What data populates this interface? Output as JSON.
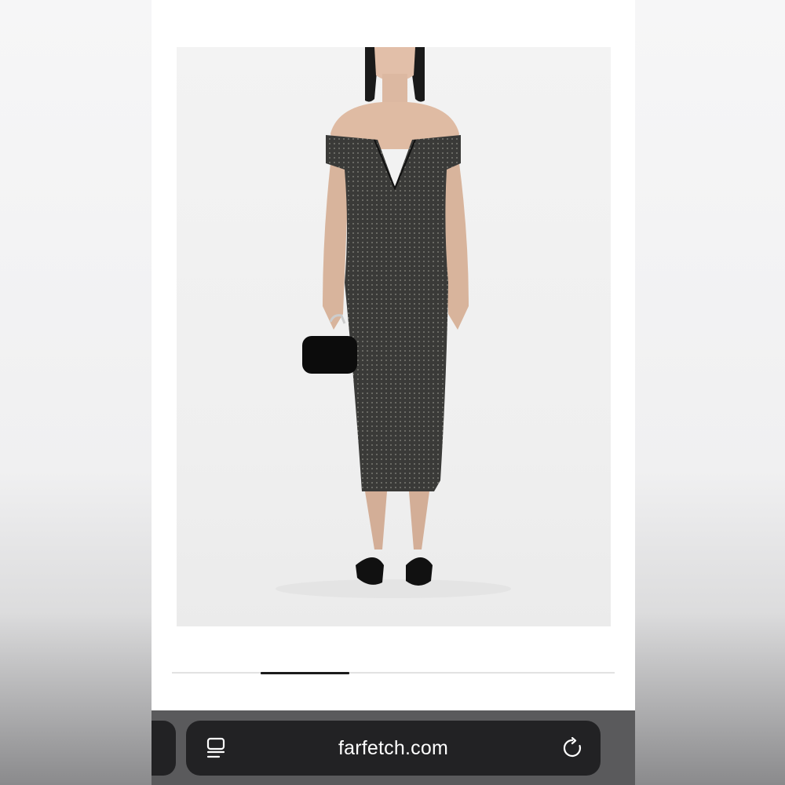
{
  "browser": {
    "url": "farfetch.com",
    "tabs_icon": "tabs-icon",
    "reload_icon": "reload-icon"
  },
  "product": {
    "image": "product-photo-off-shoulder-crystal-dress"
  },
  "carousel": {
    "progress_start": 0.2,
    "progress_end": 0.4
  },
  "colors": {
    "page_background": "#ffffff",
    "browser_bar": "#5a5a5c",
    "url_pill": "#222224",
    "carousel_active": "#1c1c1c",
    "carousel_track": "#e2e2e2"
  }
}
